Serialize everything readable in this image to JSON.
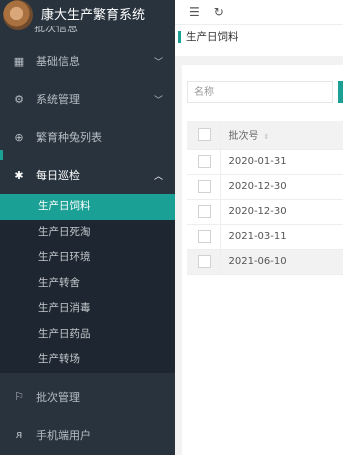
{
  "app": {
    "title": "康大生产繁育系统"
  },
  "sidebar": {
    "cut_item": "批次信息",
    "items": [
      {
        "label": "基础信息",
        "icon": "grid-icon",
        "arrow": "⌄"
      },
      {
        "label": "系统管理",
        "icon": "gear-icon",
        "arrow": "⌄"
      },
      {
        "label": "繁育种兔列表",
        "icon": "link-icon",
        "arrow": ""
      },
      {
        "label": "每日巡检",
        "icon": "rabbit-icon",
        "arrow": "⌃"
      }
    ],
    "submenu": [
      "生产日饲料",
      "生产日死淘",
      "生产日环境",
      "生产转舍",
      "生产日消毒",
      "生产日药品",
      "生产转场"
    ],
    "bottom_items": [
      {
        "label": "批次管理",
        "icon": "flag-icon"
      },
      {
        "label": "手机端用户",
        "icon": "user-icon"
      }
    ]
  },
  "tab": {
    "label": "生产日饲料"
  },
  "search": {
    "placeholder": "名称"
  },
  "table": {
    "header": "批次号",
    "rows": [
      "2020-01-31",
      "2020-12-30",
      "2020-12-30",
      "2021-03-11",
      "2021-06-10"
    ]
  }
}
